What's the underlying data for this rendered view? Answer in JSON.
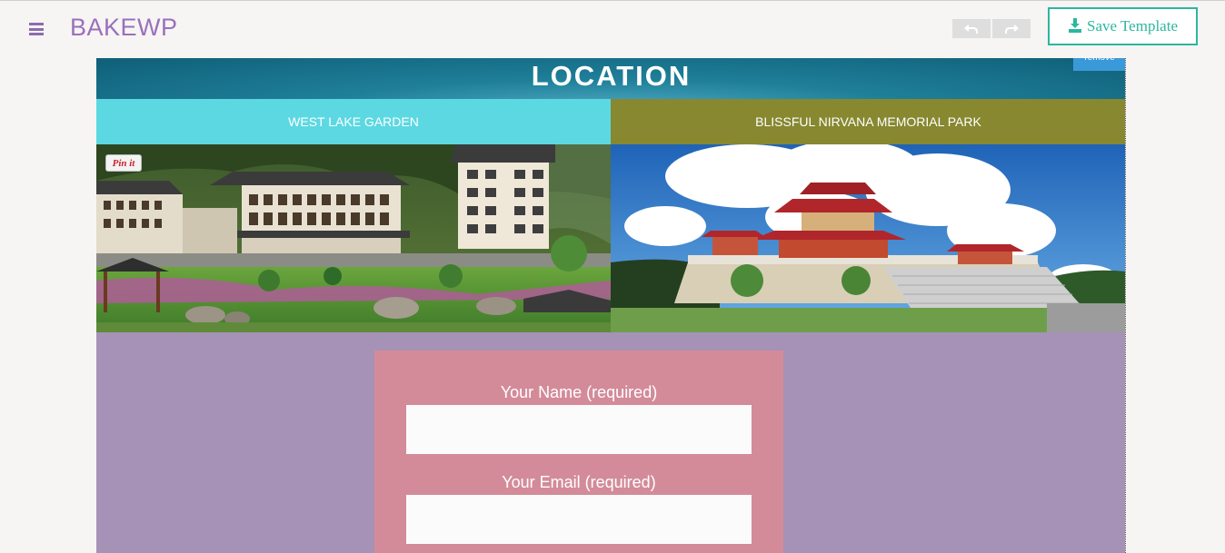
{
  "app": {
    "brand": "BAKEWP",
    "save_label": "Save Template",
    "icons": {
      "menu": "hamburger-icon",
      "undo": "undo-icon",
      "redo": "redo-icon",
      "save": "download-icon"
    }
  },
  "canvas": {
    "header": {
      "title": "LOCATION",
      "remove_label": "remove"
    },
    "columns": [
      {
        "title": "WEST LAKE GARDEN",
        "image": "pagoda-garden-photo",
        "pin_label": "Pin it",
        "title_bg": "#5cd8e2"
      },
      {
        "title": "BLISSFUL NIRVANA MEMORIAL PARK",
        "image": "temple-sky-photo",
        "title_bg": "#878830"
      }
    ],
    "form": {
      "name_label": "Your Name (required)",
      "name_value": "",
      "email_label": "Your Email (required)",
      "email_value": ""
    }
  },
  "colors": {
    "brand": "#9b6fbd",
    "accent": "#2bb7a0",
    "form_section_bg": "#a692b6",
    "form_box_bg": "#d38b99"
  }
}
